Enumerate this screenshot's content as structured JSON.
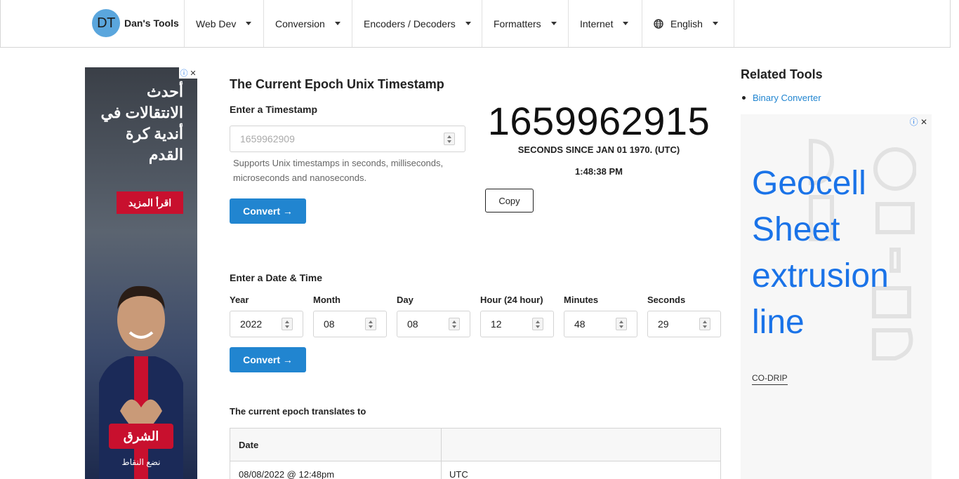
{
  "header": {
    "logo_initials": "DT",
    "brand_name": "Dan's Tools",
    "nav": [
      "Web Dev",
      "Conversion",
      "Encoders / Decoders",
      "Formatters",
      "Internet"
    ],
    "language": "English"
  },
  "left_ad": {
    "headline": "أحدث الانتقالات في أندية كرة القدم",
    "cta": "اقرأ المزيد",
    "logo": "الشرق",
    "tagline": "نضع النقاط"
  },
  "main": {
    "title": "The Current Epoch Unix Timestamp",
    "timestamp_label": "Enter a Timestamp",
    "timestamp_placeholder": "1659962909",
    "help_text": "Supports Unix timestamps in seconds, milliseconds, microseconds and nanoseconds.",
    "convert_label": "Convert →",
    "current_timestamp": "1659962915",
    "seconds_caption": "SECONDS SINCE JAN 01 1970. (UTC)",
    "current_time": "1:48:38 PM",
    "copy_label": "Copy",
    "datetime_label": "Enter a Date & Time",
    "fields": [
      {
        "label": "Year",
        "value": "2022"
      },
      {
        "label": "Month",
        "value": "08"
      },
      {
        "label": "Day",
        "value": "08"
      },
      {
        "label": "Hour (24 hour)",
        "value": "12"
      },
      {
        "label": "Minutes",
        "value": "48"
      },
      {
        "label": "Seconds",
        "value": "29"
      }
    ],
    "translates_label": "The current epoch translates to",
    "table": {
      "header": [
        "Date",
        ""
      ],
      "row": [
        "08/08/2022 @ 12:48pm",
        "UTC"
      ]
    }
  },
  "sidebar": {
    "title": "Related Tools",
    "links": [
      "Binary Converter"
    ]
  },
  "right_ad": {
    "headline": "Geocell Sheet extrusion line",
    "brand": "CO-DRIP"
  }
}
